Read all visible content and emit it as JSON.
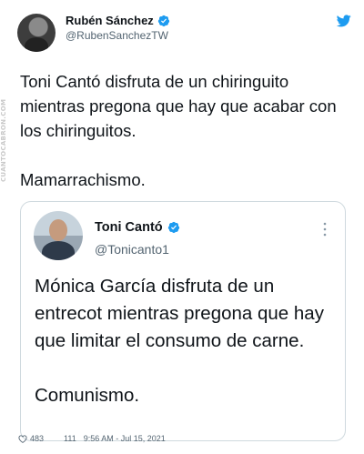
{
  "watermark": "CUANTOCABRON.COM",
  "author": {
    "display_name": "Rubén Sánchez",
    "handle": "@RubenSanchezTW"
  },
  "tweet": {
    "text": "Toni Cantó disfruta de un chiringuito mientras pregona que hay que acabar con los chiringuitos.\n\nMamarrachismo."
  },
  "quoted": {
    "display_name": "Toni Cantó",
    "handle": "@Tonicanto1",
    "text": "Mónica García disfruta de un entrecot mientras pregona que hay que limitar el consumo de carne.\n\nComunismo."
  },
  "footer": {
    "likes": "483",
    "retweets": "111",
    "timestamp": "9:56 AM - Jul 15, 2021"
  },
  "icons": {
    "verified": "verified-badge-icon",
    "twitter": "twitter-bird-icon",
    "more": "more-vertical-icon",
    "like": "heart-icon"
  },
  "colors": {
    "twitter_blue": "#1d9bf0",
    "text": "#0f1419",
    "secondary": "#536471",
    "border": "#cfd9de"
  }
}
